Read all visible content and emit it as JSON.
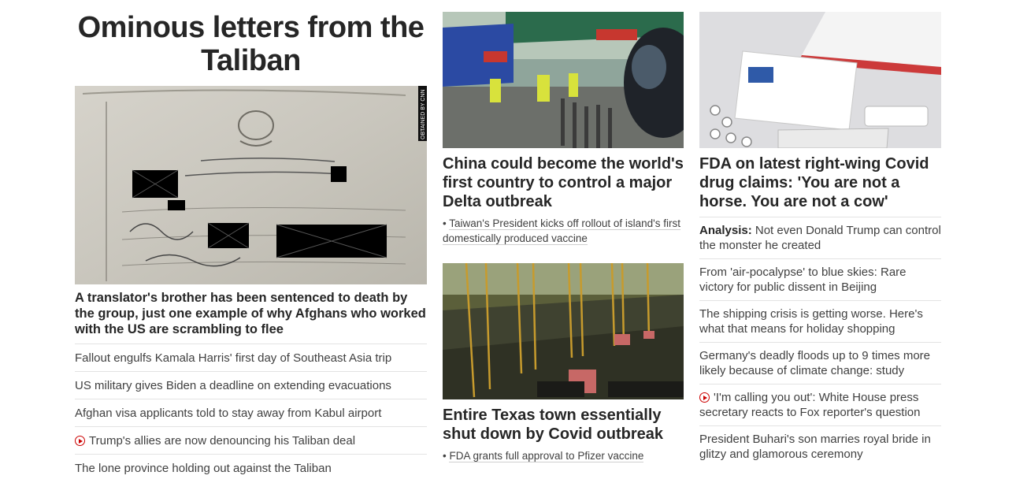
{
  "col1": {
    "headline": "Ominous letters from the Taliban",
    "image_credit": "OBTAINED BY CNN",
    "summary": "A translator's brother has been sentenced to death by the group, just one example of why Afghans who worked with the US are scrambling to flee",
    "links": [
      {
        "label": "Fallout engulfs Kamala Harris' first day of Southeast Asia trip",
        "video": false
      },
      {
        "label": "US military gives Biden a deadline on extending evacuations",
        "video": false
      },
      {
        "label": "Afghan visa applicants told to stay away from Kabul airport",
        "video": false
      },
      {
        "label": "Trump's allies are now denouncing his Taliban deal",
        "video": true
      },
      {
        "label": "The lone province holding out against the Taliban",
        "video": false
      }
    ]
  },
  "col2": {
    "story1": {
      "headline": "China could become the world's first country to control a major Delta outbreak",
      "sub": "Taiwan's President kicks off rollout of island's first domestically produced vaccine"
    },
    "story2": {
      "headline": "Entire Texas town essentially shut down by Covid outbreak",
      "sub": "FDA grants full approval to Pfizer vaccine"
    }
  },
  "col3": {
    "headline": "FDA on latest right-wing Covid drug claims: 'You are not a horse. You are not a cow'",
    "links": [
      {
        "prefix": "Analysis:",
        "label": "Not even Donald Trump can control the monster he created",
        "video": false
      },
      {
        "prefix": "",
        "label": "From 'air-pocalypse' to blue skies: Rare victory for public dissent in Beijing",
        "video": false
      },
      {
        "prefix": "",
        "label": "The shipping crisis is getting worse. Here's what that means for holiday shopping",
        "video": false
      },
      {
        "prefix": "",
        "label": "Germany's deadly floods up to 9 times more likely because of climate change: study",
        "video": false
      },
      {
        "prefix": "",
        "label": "'I'm calling you out': White House press secretary reacts to Fox reporter's question",
        "video": true
      },
      {
        "prefix": "",
        "label": "President Buhari's son marries royal bride in glitzy and glamorous ceremony",
        "video": false
      }
    ]
  },
  "colors": {
    "video_icon": "#cc0000",
    "text": "#262626",
    "divider": "#e3e3e3"
  }
}
